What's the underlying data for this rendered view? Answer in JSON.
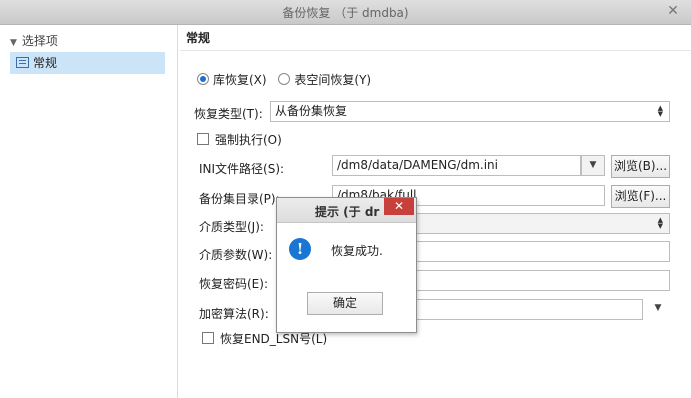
{
  "window": {
    "title": "备份恢复 （于 dmdba)",
    "close_glyph": "✕"
  },
  "sidebar": {
    "header": "选择项",
    "items": [
      {
        "label": "常规"
      }
    ]
  },
  "main": {
    "section_title": "常规",
    "restore_mode": {
      "options": [
        {
          "label": "库恢复(X)",
          "selected": true
        },
        {
          "label": "表空间恢复(Y)",
          "selected": false
        }
      ]
    },
    "restore_type": {
      "label": "恢复类型(T):",
      "value": "从备份集恢复"
    },
    "force_exec": {
      "label": "强制执行(O)",
      "checked": false
    },
    "ini_path": {
      "label": "INI文件路径(S):",
      "value": "/dm8/data/DAMENG/dm.ini",
      "browse": "浏览(B)..."
    },
    "backup_dir": {
      "label": "备份集目录(P):",
      "value": "/dm8/bak/full",
      "browse": "浏览(F)..."
    },
    "media_type": {
      "label": "介质类型(J):",
      "value": ""
    },
    "media_param": {
      "label": "介质参数(W):",
      "value": ""
    },
    "restore_password": {
      "label": "恢复密码(E):",
      "value": ""
    },
    "encrypt_alg": {
      "label": "加密算法(R):",
      "value": ""
    },
    "restore_end_lsn": {
      "label": "恢复END_LSN号(L)",
      "checked": false
    }
  },
  "dialog": {
    "title": "提示   (于 dr",
    "close_glyph": "✕",
    "icon_glyph": "!",
    "message": "恢复成功.",
    "ok_button": "确定"
  },
  "colors": {
    "selection": "#cce4f7",
    "info_icon": "#1976d2",
    "dialog_close": "#c7403b",
    "radio_dot": "#1e6fd0"
  }
}
